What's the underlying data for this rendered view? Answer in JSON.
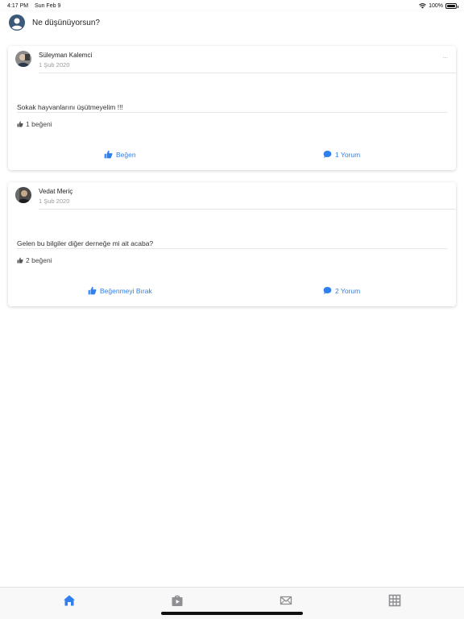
{
  "status_bar": {
    "time": "4:17 PM",
    "date": "Sun Feb 9",
    "battery": "100%",
    "wifi_icon": "wifi-icon",
    "battery_icon": "battery-icon"
  },
  "composer": {
    "placeholder": "Ne düşünüyorsun?",
    "avatar_icon": "user-avatar-icon"
  },
  "posts": [
    {
      "author": "Süleyman Kalemci",
      "date": "1 Şub 2020",
      "menu": "...",
      "text": "Sokak hayvanlarını üşütmeyelim !!!",
      "likes": "1 beğeni",
      "like_action": "Beğen",
      "comment_action": "1 Yorum"
    },
    {
      "author": "Vedat Meriç",
      "date": "1 Şub 2020",
      "menu": "",
      "text": "Gelen bu bilgiler diğer derneğe mi ait acaba?",
      "likes": "2 beğeni",
      "like_action": "Beğenmeyi Bırak",
      "comment_action": "2 Yorum"
    }
  ],
  "tab_bar": {
    "tabs": [
      {
        "icon": "home-icon",
        "active": true
      },
      {
        "icon": "video-bag-icon",
        "active": false
      },
      {
        "icon": "mail-icon",
        "active": false
      },
      {
        "icon": "grid-icon",
        "active": false
      }
    ],
    "active_color": "#2f80ed",
    "inactive_color": "#8e8e93"
  },
  "colors": {
    "accent": "#2f80ed"
  }
}
